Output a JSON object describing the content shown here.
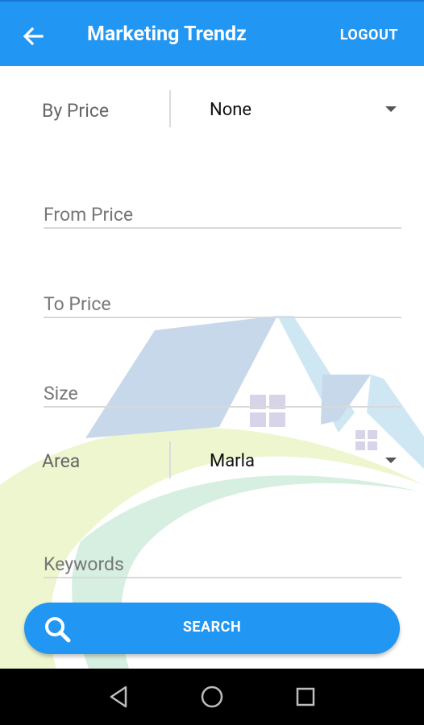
{
  "appbar": {
    "title": "Marketing Trendz",
    "logout_label": "LOGOUT"
  },
  "form": {
    "price_label": "By Price",
    "price_selected": "None",
    "from_price_placeholder": "From Price",
    "to_price_placeholder": "To Price",
    "size_placeholder": "Size",
    "area_label": "Area",
    "area_selected": "Marla",
    "keywords_placeholder": "Keywords"
  },
  "search_button": {
    "label": "SEARCH"
  },
  "icons": {
    "back": "arrow-back-icon",
    "search": "search-icon",
    "nav_back": "triangle-back-icon",
    "nav_home": "circle-home-icon",
    "nav_recents": "square-recents-icon"
  },
  "colors": {
    "primary": "#2196f3",
    "navbar": "#000000"
  }
}
